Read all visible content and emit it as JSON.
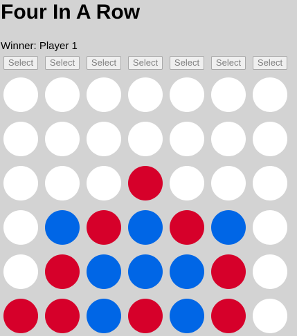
{
  "game": {
    "title": "Four In A Row",
    "status": "Winner: Player 1",
    "select_label": "Select",
    "columns": 7,
    "rows": 6
  },
  "colors": {
    "empty": "#ffffff",
    "player1": "#d6002a",
    "player2": "#0066e6"
  },
  "board": [
    [
      "empty",
      "empty",
      "empty",
      "empty",
      "empty",
      "empty",
      "empty"
    ],
    [
      "empty",
      "empty",
      "empty",
      "empty",
      "empty",
      "empty",
      "empty"
    ],
    [
      "empty",
      "empty",
      "empty",
      "player1",
      "empty",
      "empty",
      "empty"
    ],
    [
      "empty",
      "player2",
      "player1",
      "player2",
      "player1",
      "player2",
      "empty"
    ],
    [
      "empty",
      "player1",
      "player2",
      "player2",
      "player2",
      "player1",
      "empty"
    ],
    [
      "player1",
      "player1",
      "player2",
      "player1",
      "player2",
      "player1",
      "empty"
    ]
  ]
}
